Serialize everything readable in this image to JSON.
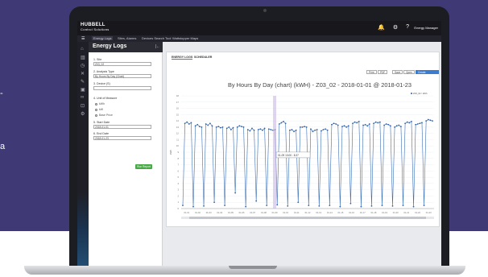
{
  "marketing": {
    "line1": "-",
    "line2": "a"
  },
  "app": {
    "logo_main": "HUBBELL",
    "logo_sub": "Control Solutions",
    "icons": [
      "bell-icon",
      "gear-icon",
      "help-icon"
    ],
    "user": "Energy Manager",
    "nav": [
      "Energy Logs",
      "Sites, Alarms",
      "Devices Search Tool",
      "Wattstopper Maps"
    ]
  },
  "panel": {
    "title": "Energy Logs",
    "site_label": "1. Site",
    "site_value": "Z03_02",
    "analysis_label": "2. Analysis Type",
    "analysis_value": "By Hours By Day (Chart)",
    "device_label": "3. Device (S)",
    "device_value": "",
    "unit_label": "4. Unit of Measure",
    "radios": [
      "kWh",
      "kW",
      "Base Price"
    ],
    "start_label": "5. Start Date",
    "start_value": "2018-01-01",
    "end_label": "6. End Date",
    "end_value": "2018-01-23",
    "run_label": "Run Report"
  },
  "main": {
    "tabs": [
      "ENERGY LOGS",
      "SCHEDULER"
    ],
    "toolbar": [
      "Print",
      "PDF",
      "Save",
      "Open",
      "Create Schedule"
    ],
    "legend": "Z03_02 / kWh"
  },
  "chart_data": {
    "type": "line",
    "title": "By Hours By Day (chart) (kWH) - Z03_02 - 2018-01-01 @ 2018-01-23",
    "ylabel": "kWh",
    "ylim": [
      0,
      18
    ],
    "yticks": [
      "0",
      "1",
      "2",
      "3",
      "4",
      "5",
      "6",
      "7",
      "8",
      "9",
      "10",
      "11",
      "12",
      "13",
      "14",
      "15",
      "16",
      "17",
      "18"
    ],
    "xlabels": [
      "01-01",
      "01-02",
      "01-03",
      "01-04",
      "01-05",
      "01-06",
      "01-07",
      "01-08",
      "01-09",
      "01-10",
      "01-11",
      "01-12",
      "01-13",
      "01-14",
      "01-15",
      "01-16",
      "01-17",
      "01-18",
      "01-19",
      "01-20",
      "01-21",
      "01-22",
      "01-23"
    ],
    "tooltip": "01-09 13:00 : 8.37",
    "series": [
      {
        "name": "Z03_02 / kWh",
        "values": [
          0.5,
          13.6,
          13.8,
          13.5,
          13.7,
          0.3,
          13.2,
          13.4,
          13.1,
          13.0,
          0.4,
          13.5,
          13.3,
          13.6,
          13.2,
          1.0,
          13.0,
          13.1,
          12.9,
          13.0,
          0.5,
          12.8,
          13.0,
          12.6,
          12.9,
          2.5,
          13.0,
          13.2,
          13.1,
          13.0,
          0.3,
          12.6,
          12.4,
          12.8,
          12.5,
          1.2,
          12.6,
          12.7,
          12.5,
          12.8,
          0.5,
          12.7,
          12.6,
          12.5,
          12.6,
          0.6,
          13.5,
          13.7,
          13.9,
          13.6,
          0.4,
          12.5,
          12.6,
          12.3,
          12.5,
          1.0,
          13.0,
          13.0,
          13.1,
          13.0,
          0.5,
          12.7,
          12.3,
          12.5,
          12.6,
          0.4,
          12.4,
          12.6,
          12.7,
          12.5,
          0.5,
          13.4,
          13.6,
          13.5,
          13.3,
          0.3,
          13.1,
          13.2,
          13.0,
          13.2,
          0.8,
          13.6,
          13.8,
          13.7,
          13.9,
          0.3,
          13.3,
          13.4,
          13.2,
          13.5,
          0.4,
          13.6,
          13.8,
          13.7,
          13.8,
          0.5,
          13.3,
          13.5,
          13.4,
          13.2,
          0.4,
          13.0,
          13.2,
          13.3,
          13.1,
          0.5,
          13.6,
          13.8,
          13.7,
          13.9,
          0.3,
          13.4,
          13.5,
          13.6,
          13.7,
          0.5,
          14.0,
          14.2,
          14.1,
          14.0
        ]
      }
    ]
  }
}
